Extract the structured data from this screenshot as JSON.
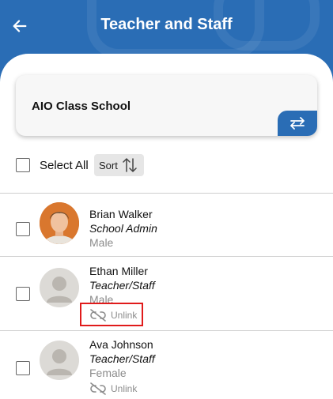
{
  "header": {
    "title": "Teacher and Staff",
    "back_icon": "arrow-left-icon",
    "color": "#2a6db5"
  },
  "school": {
    "name": "AIO Class School",
    "switch_icon": "swap-arrows-icon"
  },
  "controls": {
    "select_all_label": "Select All",
    "sort_label": "Sort",
    "sort_icon": "sort-arrows-icon"
  },
  "staff": [
    {
      "name": "Brian Walker",
      "role": "School Admin",
      "gender": "Male",
      "checked": false,
      "photo": true
    },
    {
      "name": "Ethan Miller",
      "role": "Teacher/Staff",
      "gender": "Male",
      "action": "Unlink",
      "checked": false,
      "photo": false
    },
    {
      "name": "Ava Johnson",
      "role": "Teacher/Staff",
      "gender": "Female",
      "action": "Unlink",
      "checked": false,
      "photo": false
    }
  ],
  "highlight_color": "#e01b1b"
}
